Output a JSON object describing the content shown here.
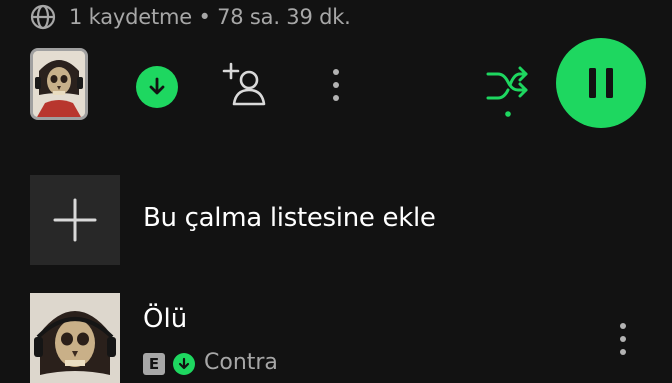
{
  "playlist": {
    "meta": "1 kaydetme • 78 sa. 39 dk."
  },
  "actions": {
    "download_icon": "download-icon",
    "add_collaborator_icon": "add-user-icon",
    "more_icon": "more-vertical-icon",
    "shuffle_icon": "shuffle-icon",
    "play_state": "pause"
  },
  "add_to_playlist": {
    "label": "Bu çalma listesine ekle"
  },
  "tracks": [
    {
      "title": "Ölü",
      "explicit_badge": "E",
      "downloaded": true,
      "artist": "Contra"
    }
  ],
  "colors": {
    "background": "#121212",
    "accent": "#1ed760",
    "secondary_text": "#a7a7a7",
    "tile": "#282828"
  }
}
